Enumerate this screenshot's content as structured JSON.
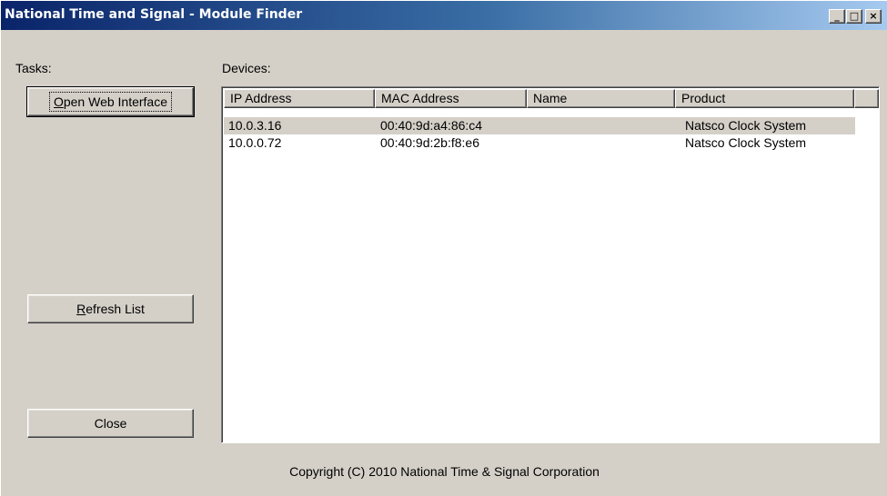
{
  "window": {
    "title": "National Time and Signal - Module Finder",
    "controls": {
      "minimize": "_",
      "maximize": "□",
      "close": "×"
    }
  },
  "tasks": {
    "label": "Tasks:",
    "open_web_interface": {
      "pre": "",
      "accel": "O",
      "post": "pen Web Interface"
    },
    "refresh_list": {
      "pre": "",
      "accel": "R",
      "post": "efresh List"
    },
    "close": "Close"
  },
  "devices": {
    "label": "Devices:",
    "columns": [
      "IP Address",
      "MAC Address",
      "Name",
      "Product",
      ""
    ],
    "rows": [
      {
        "ip": "10.0.3.16",
        "mac": "00:40:9d:a4:86:c4",
        "name": "",
        "product": "Natsco Clock System",
        "selected": true
      },
      {
        "ip": "10.0.0.72",
        "mac": "00:40:9d:2b:f8:e6",
        "name": "",
        "product": "Natsco Clock System",
        "selected": false
      }
    ]
  },
  "footer": {
    "copyright": "Copyright (C) 2010 National Time & Signal Corporation"
  },
  "colors": {
    "titlebar_start": "#0a246a",
    "titlebar_end": "#a6caf0",
    "face": "#d4d0c8",
    "list_bg": "#ffffff"
  }
}
